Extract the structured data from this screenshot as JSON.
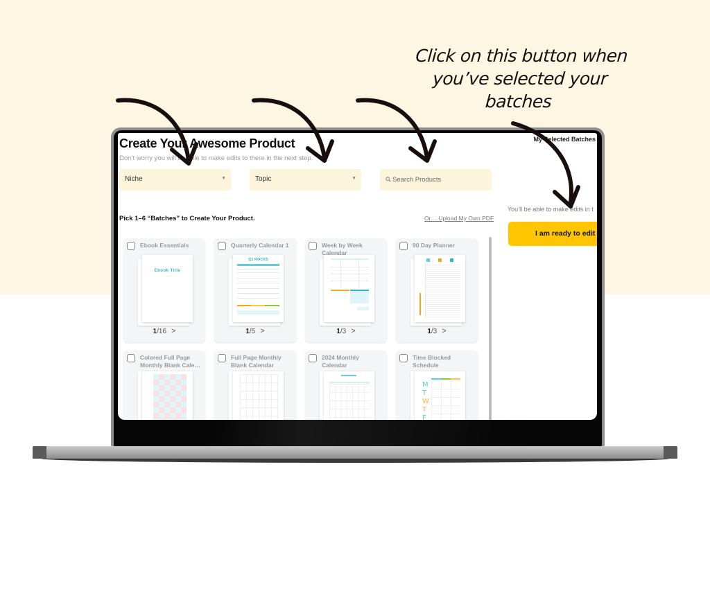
{
  "annotation": {
    "callout_lines": [
      "Click on this button when",
      "you’ve selected your",
      "batches"
    ]
  },
  "app": {
    "title": "Create Your Awesome Product",
    "subtitle": "Don’t worry you will be able to make edits to there in the next step.",
    "selected_panel": {
      "label": "My Selected Batches",
      "hint": "You’ll be able to make edits in t",
      "ready_button": "I am ready to edit i"
    },
    "filters": {
      "niche": {
        "value": "Niche",
        "icon": "chevron-down-icon"
      },
      "topic": {
        "value": "Topic",
        "icon": "chevron-down-icon"
      },
      "search": {
        "placeholder": "Search Products",
        "icon": "search-icon"
      }
    },
    "pick_label": "Pick 1–6 “Batches” to Create Your Product.",
    "upload_link": "Or… Upload My Own PDF",
    "batches": [
      {
        "name": "Ebook Essentials",
        "current": "1",
        "total": "/16",
        "preview_title": "Ebook Title",
        "checked": false
      },
      {
        "name": "Quarterly Calendar 1",
        "current": "1",
        "total": "/5",
        "preview_title": "Q1 ROCKS",
        "checked": false
      },
      {
        "name": "Week by Week Calendar",
        "current": "1",
        "total": "/3",
        "checked": false
      },
      {
        "name": "90 Day Planner",
        "current": "1",
        "total": "/3",
        "checked": false
      },
      {
        "name": "Colored Full Page Monthly Blank Cale…",
        "checked": false
      },
      {
        "name": "Full Page Monthly Blank Calendar",
        "checked": false
      },
      {
        "name": "2024 Monthly Calendar",
        "checked": false
      },
      {
        "name": "Time Blocked Schedule",
        "preview_letters": [
          "M",
          "T",
          "W",
          "T",
          "F"
        ],
        "checked": false
      }
    ],
    "next_glyph": ">",
    "colors": {
      "accent_yellow": "#ffc500",
      "field_bg": "#fdf4dc",
      "teal": "#2ab8c8",
      "orange": "#f5a623",
      "green": "#8cc63f",
      "page_bg_cream": "#fdf6e2"
    }
  }
}
